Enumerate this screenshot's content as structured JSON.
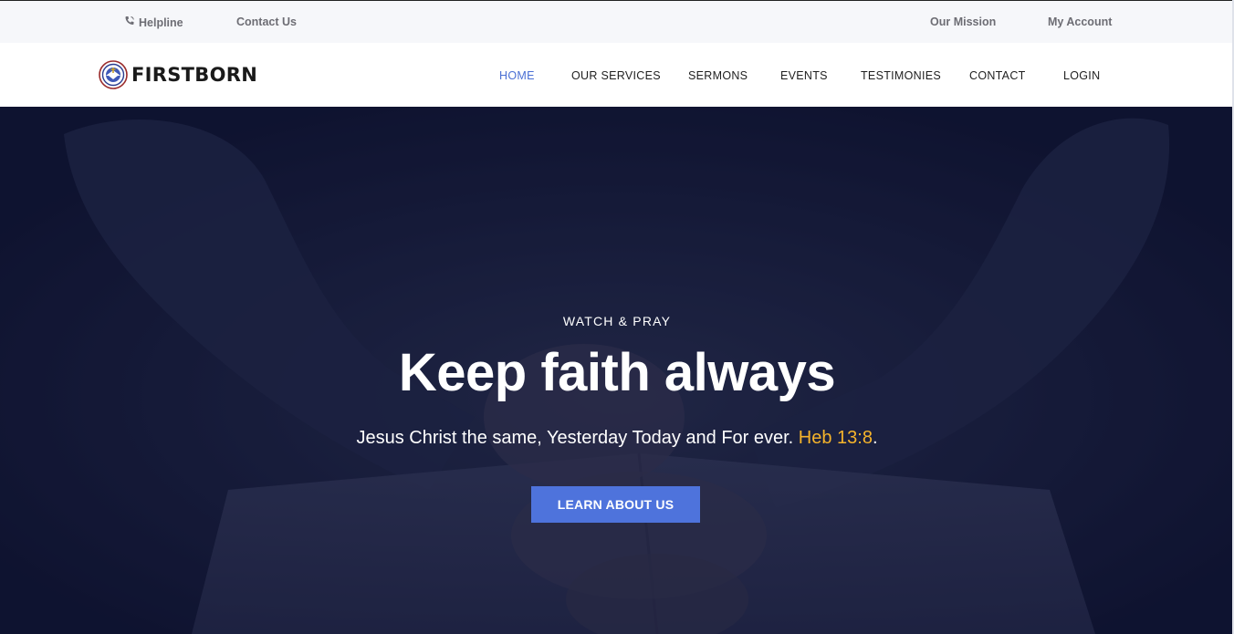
{
  "topbar": {
    "helpline": "Helpline",
    "contact": "Contact Us",
    "mission": "Our Mission",
    "account": "My Account"
  },
  "brand": {
    "name": "FIRSTBORN"
  },
  "nav": {
    "items": [
      {
        "label": "HOME",
        "active": true
      },
      {
        "label": "OUR SERVICES"
      },
      {
        "label": "SERMONS"
      },
      {
        "label": "EVENTS"
      },
      {
        "label": "TESTIMONIES"
      },
      {
        "label": "CONTACT"
      },
      {
        "label": "LOGIN"
      }
    ]
  },
  "hero": {
    "subtitle": "WATCH & PRAY",
    "title": "Keep faith always",
    "verse_text": "Jesus Christ the same, Yesterday Today and For ever.",
    "verse_ref": "Heb 13:8",
    "verse_end": ".",
    "button_label": "LEARN ABOUT US"
  },
  "colors": {
    "accent": "#4e73dc",
    "nav_active": "#4a6fd4",
    "verse_ref": "#f6b42b",
    "hero_overlay": "#131833"
  },
  "icons": {
    "helpline": "phone-icon",
    "logo": "church-emblem-icon"
  }
}
